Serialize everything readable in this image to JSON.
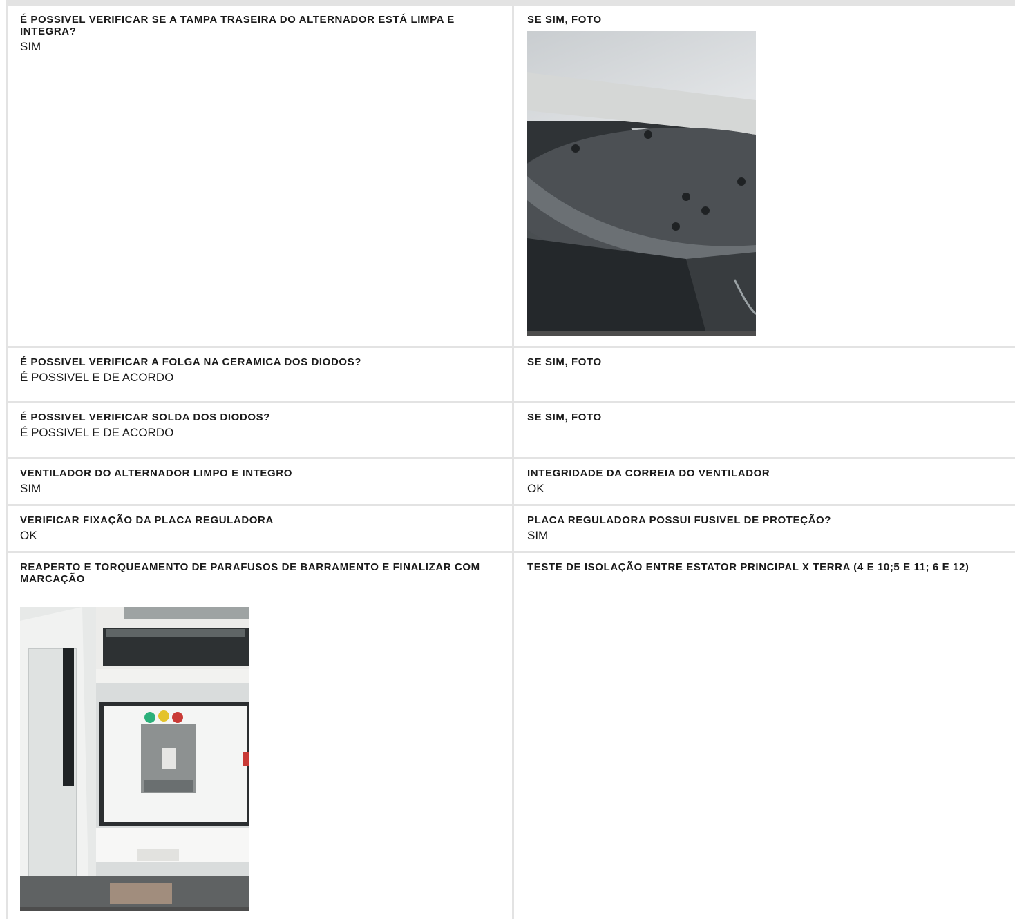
{
  "rows": [
    {
      "left": {
        "label": "É POSSIVEL VERIFICAR SE A TAMPA TRASEIRA DO ALTERNADOR ESTÁ LIMPA E INTEGRA?",
        "value": "SIM"
      },
      "right": {
        "label": "SE SIM, FOTO",
        "photo": "alternator-rear-cover-photo"
      }
    },
    {
      "left": {
        "label": "É POSSIVEL VERIFICAR A FOLGA NA CERAMICA DOS DIODOS?",
        "value": "É POSSIVEL E DE ACORDO"
      },
      "right": {
        "label": "SE SIM, FOTO"
      }
    },
    {
      "left": {
        "label": "É POSSIVEL VERIFICAR SOLDA DOS DIODOS?",
        "value": "É POSSIVEL E DE ACORDO"
      },
      "right": {
        "label": "SE SIM, FOTO"
      }
    },
    {
      "left": {
        "label": "VENTILADOR DO ALTERNADOR LIMPO E INTEGRO",
        "value": "SIM"
      },
      "right": {
        "label": "INTEGRIDADE DA CORREIA DO VENTILADOR",
        "value": "OK"
      }
    },
    {
      "left": {
        "label": "VERIFICAR FIXAÇÃO DA PLACA REGULADORA",
        "value": "OK"
      },
      "right": {
        "label": "PLACA REGULADORA POSSUI FUSIVEL DE PROTEÇÃO?",
        "value": "SIM"
      }
    },
    {
      "left": {
        "label": "REAPERTO E TORQUEAMENTO DE PARAFUSOS DE BARRAMENTO E FINALIZAR COM MARCAÇÃO",
        "photo": "busbar-panel-photo"
      },
      "right": {
        "label": "TESTE DE ISOLAÇÃO ENTRE ESTATOR PRINCIPAL X TERRA (4 E 10;5 E 11; 6 E 12)"
      }
    }
  ]
}
